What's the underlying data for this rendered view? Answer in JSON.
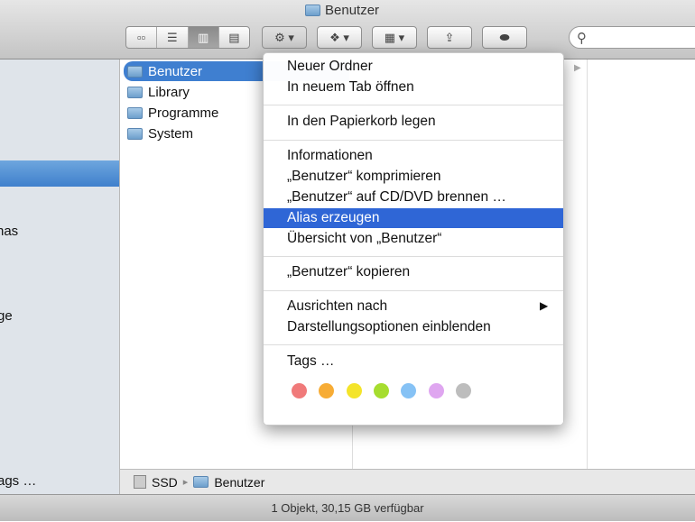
{
  "window": {
    "title": "Benutzer"
  },
  "toolbar": {
    "view_icons": [
      "icon-view",
      "list-view",
      "column-view",
      "coverflow-view"
    ],
    "action": "⚙ ▾",
    "dropbox": "❖ ▾",
    "arrange": "▦ ▾",
    "share": "⇪",
    "tags": "⬬",
    "search_placeholder": ""
  },
  "sidebar": {
    "partial_items": [
      "nas",
      "ge",
      "ags …"
    ]
  },
  "column1": {
    "items": [
      "Benutzer",
      "Library",
      "Programme",
      "System"
    ]
  },
  "context_menu": {
    "items": [
      "Neuer Ordner",
      "In neuem Tab öffnen",
      "In den Papierkorb legen",
      "Informationen",
      "„Benutzer“ komprimieren",
      "„Benutzer“ auf CD/DVD brennen …",
      "Alias erzeugen",
      "Übersicht von „Benutzer“",
      "„Benutzer“ kopieren",
      "Ausrichten nach",
      "Darstellungsoptionen einblenden",
      "Tags …"
    ],
    "highlighted": "Alias erzeugen",
    "submenu_arrow": "▶",
    "tag_colors": [
      "#f07a7a",
      "#f7ac35",
      "#f4e42a",
      "#a6dd2f",
      "#86c2f5",
      "#dfa6f0",
      "#bdbdbd"
    ]
  },
  "pathbar": {
    "items": [
      "SSD",
      "Benutzer"
    ],
    "separator": "▸"
  },
  "status": {
    "text": "1 Objekt, 30,15 GB verfügbar"
  }
}
